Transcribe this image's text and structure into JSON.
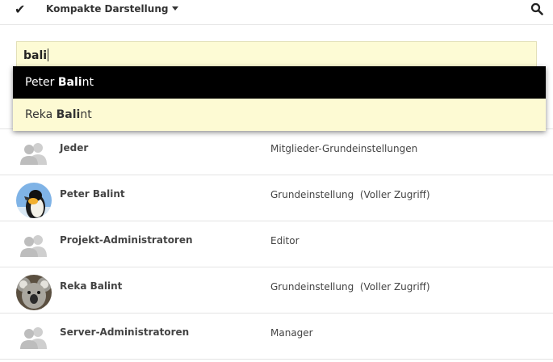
{
  "toolbar": {
    "check_icon": "checkmark-icon",
    "view_label": "Kompakte Darstellung",
    "search_icon": "search-icon"
  },
  "search": {
    "value": "bali"
  },
  "suggestions": [
    {
      "prefix": "Peter ",
      "match": "Bali",
      "suffix": "nt",
      "active": true
    },
    {
      "prefix": "Reka ",
      "match": "Bali",
      "suffix": "nt",
      "active": false
    }
  ],
  "members": [
    {
      "name": "Jeder",
      "role": "Mitglieder-Grundeinstellungen",
      "avatar": "group-icon"
    },
    {
      "name": "Peter Balint",
      "role": "Grundeinstellung  (Voller Zugriff)",
      "avatar": "penguin-avatar"
    },
    {
      "name": "Projekt-Administratoren",
      "role": "Editor",
      "avatar": "group-icon"
    },
    {
      "name": "Reka Balint",
      "role": "Grundeinstellung  (Voller Zugriff)",
      "avatar": "koala-avatar"
    },
    {
      "name": "Server-Administratoren",
      "role": "Manager",
      "avatar": "group-icon"
    }
  ],
  "colors": {
    "input_bg": "#fdfbd5",
    "active_option_bg": "#000000",
    "option_bg": "#fdfad3"
  }
}
